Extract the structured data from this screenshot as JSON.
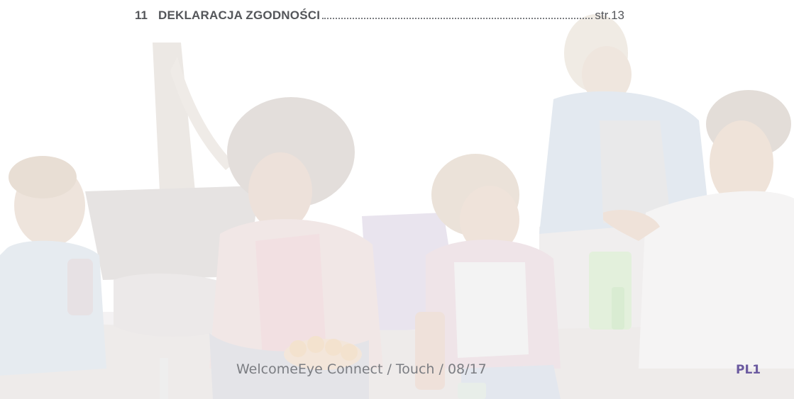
{
  "toc_entry": {
    "number": "11",
    "title": "DEKLARACJA ZGODNOŚCI",
    "page": "str.13"
  },
  "footer": {
    "product": "WelcomeEye Connect / Touch / 08/17",
    "page_code": "PL1"
  }
}
